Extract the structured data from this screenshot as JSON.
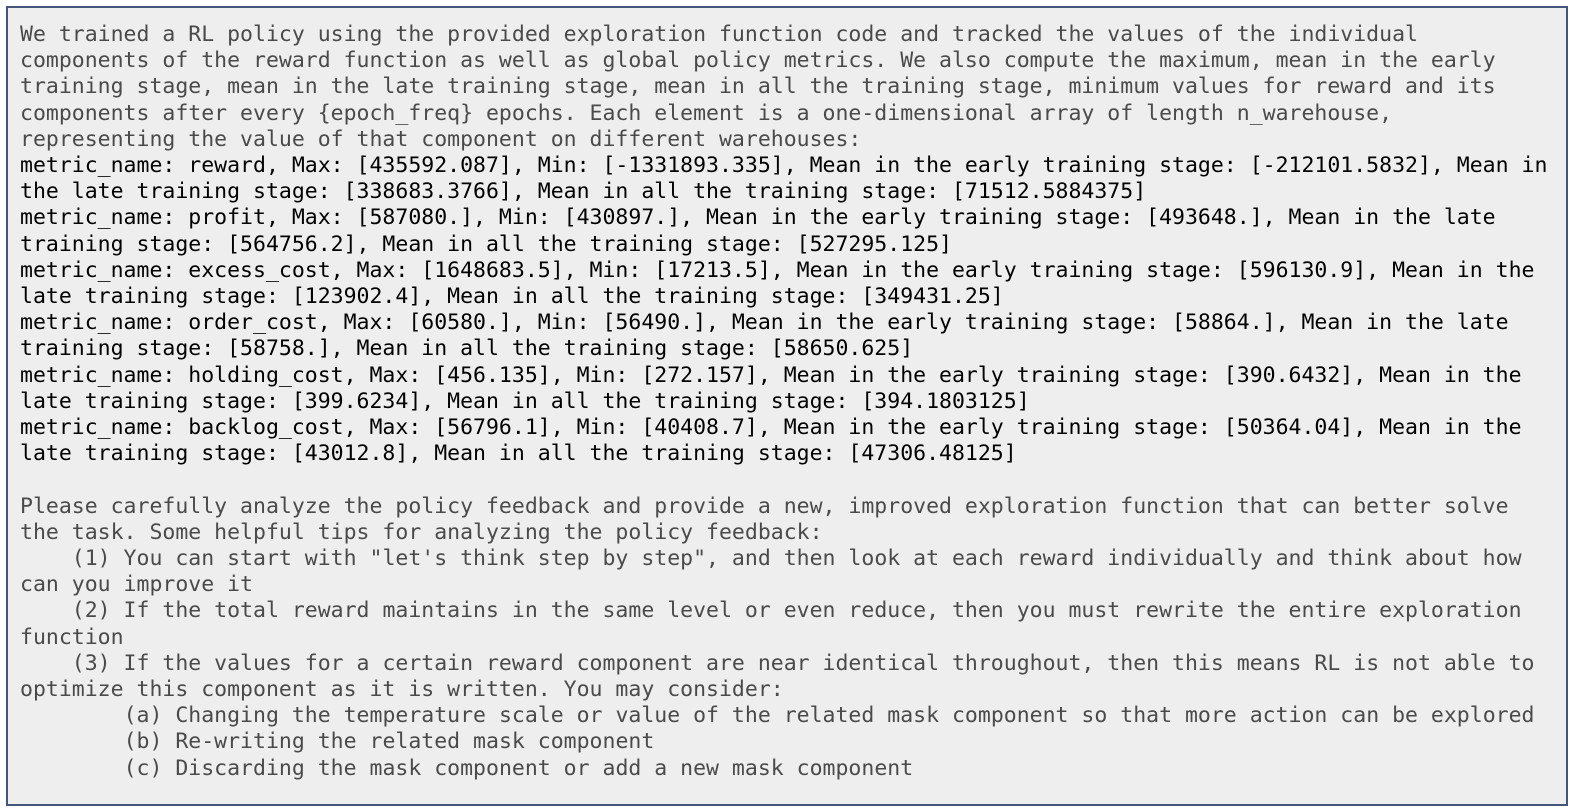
{
  "intro": "We trained a RL policy using the provided exploration function code and tracked the values of the individual components of the reward function as well as global policy metrics. We also compute the maximum, mean in the early training stage, mean in the late training stage, mean in all the training stage, minimum values for reward and its components after every {epoch_freq} epochs. Each element is a one-dimensional array of length n_warehouse, representing the value of that component on different warehouses:",
  "metrics": [
    "metric_name: reward, Max: [435592.087], Min: [-1331893.335], Mean in the early training stage: [-212101.5832], Mean in the late training stage: [338683.3766], Mean in all the training stage: [71512.5884375]",
    "metric_name: profit, Max: [587080.], Min: [430897.], Mean in the early training stage: [493648.], Mean in the late training stage: [564756.2], Mean in all the training stage: [527295.125]",
    "metric_name: excess_cost, Max: [1648683.5], Min: [17213.5], Mean in the early training stage: [596130.9], Mean in the late training stage: [123902.4], Mean in all the training stage: [349431.25]",
    "metric_name: order_cost, Max: [60580.], Min: [56490.], Mean in the early training stage: [58864.], Mean in the late training stage: [58758.], Mean in all the training stage: [58650.625]",
    "metric_name: holding_cost, Max: [456.135], Min: [272.157], Mean in the early training stage: [390.6432], Mean in the late training stage: [399.6234], Mean in all the training stage: [394.1803125]",
    "metric_name: backlog_cost, Max: [56796.1], Min: [40408.7], Mean in the early training stage: [50364.04], Mean in the late training stage: [43012.8], Mean in all the training stage: [47306.48125]"
  ],
  "instruction": "Please carefully analyze the policy feedback and provide a new, improved exploration function that can better solve the task. Some helpful tips for analyzing the policy feedback:",
  "tips": [
    "    (1) You can start with \"let's think step by step\", and then look at each reward individually and think about how can you improve it",
    "    (2) If the total reward maintains in the same level or even reduce, then you must rewrite the entire exploration function",
    "    (3) If the values for a certain reward component are near identical throughout, then this means RL is not able to optimize this component as it is written. You may consider:",
    "        (a) Changing the temperature scale or value of the related mask component so that more action can be explored",
    "        (b) Re-writing the related mask component",
    "        (c) Discarding the mask component or add a new mask component"
  ]
}
